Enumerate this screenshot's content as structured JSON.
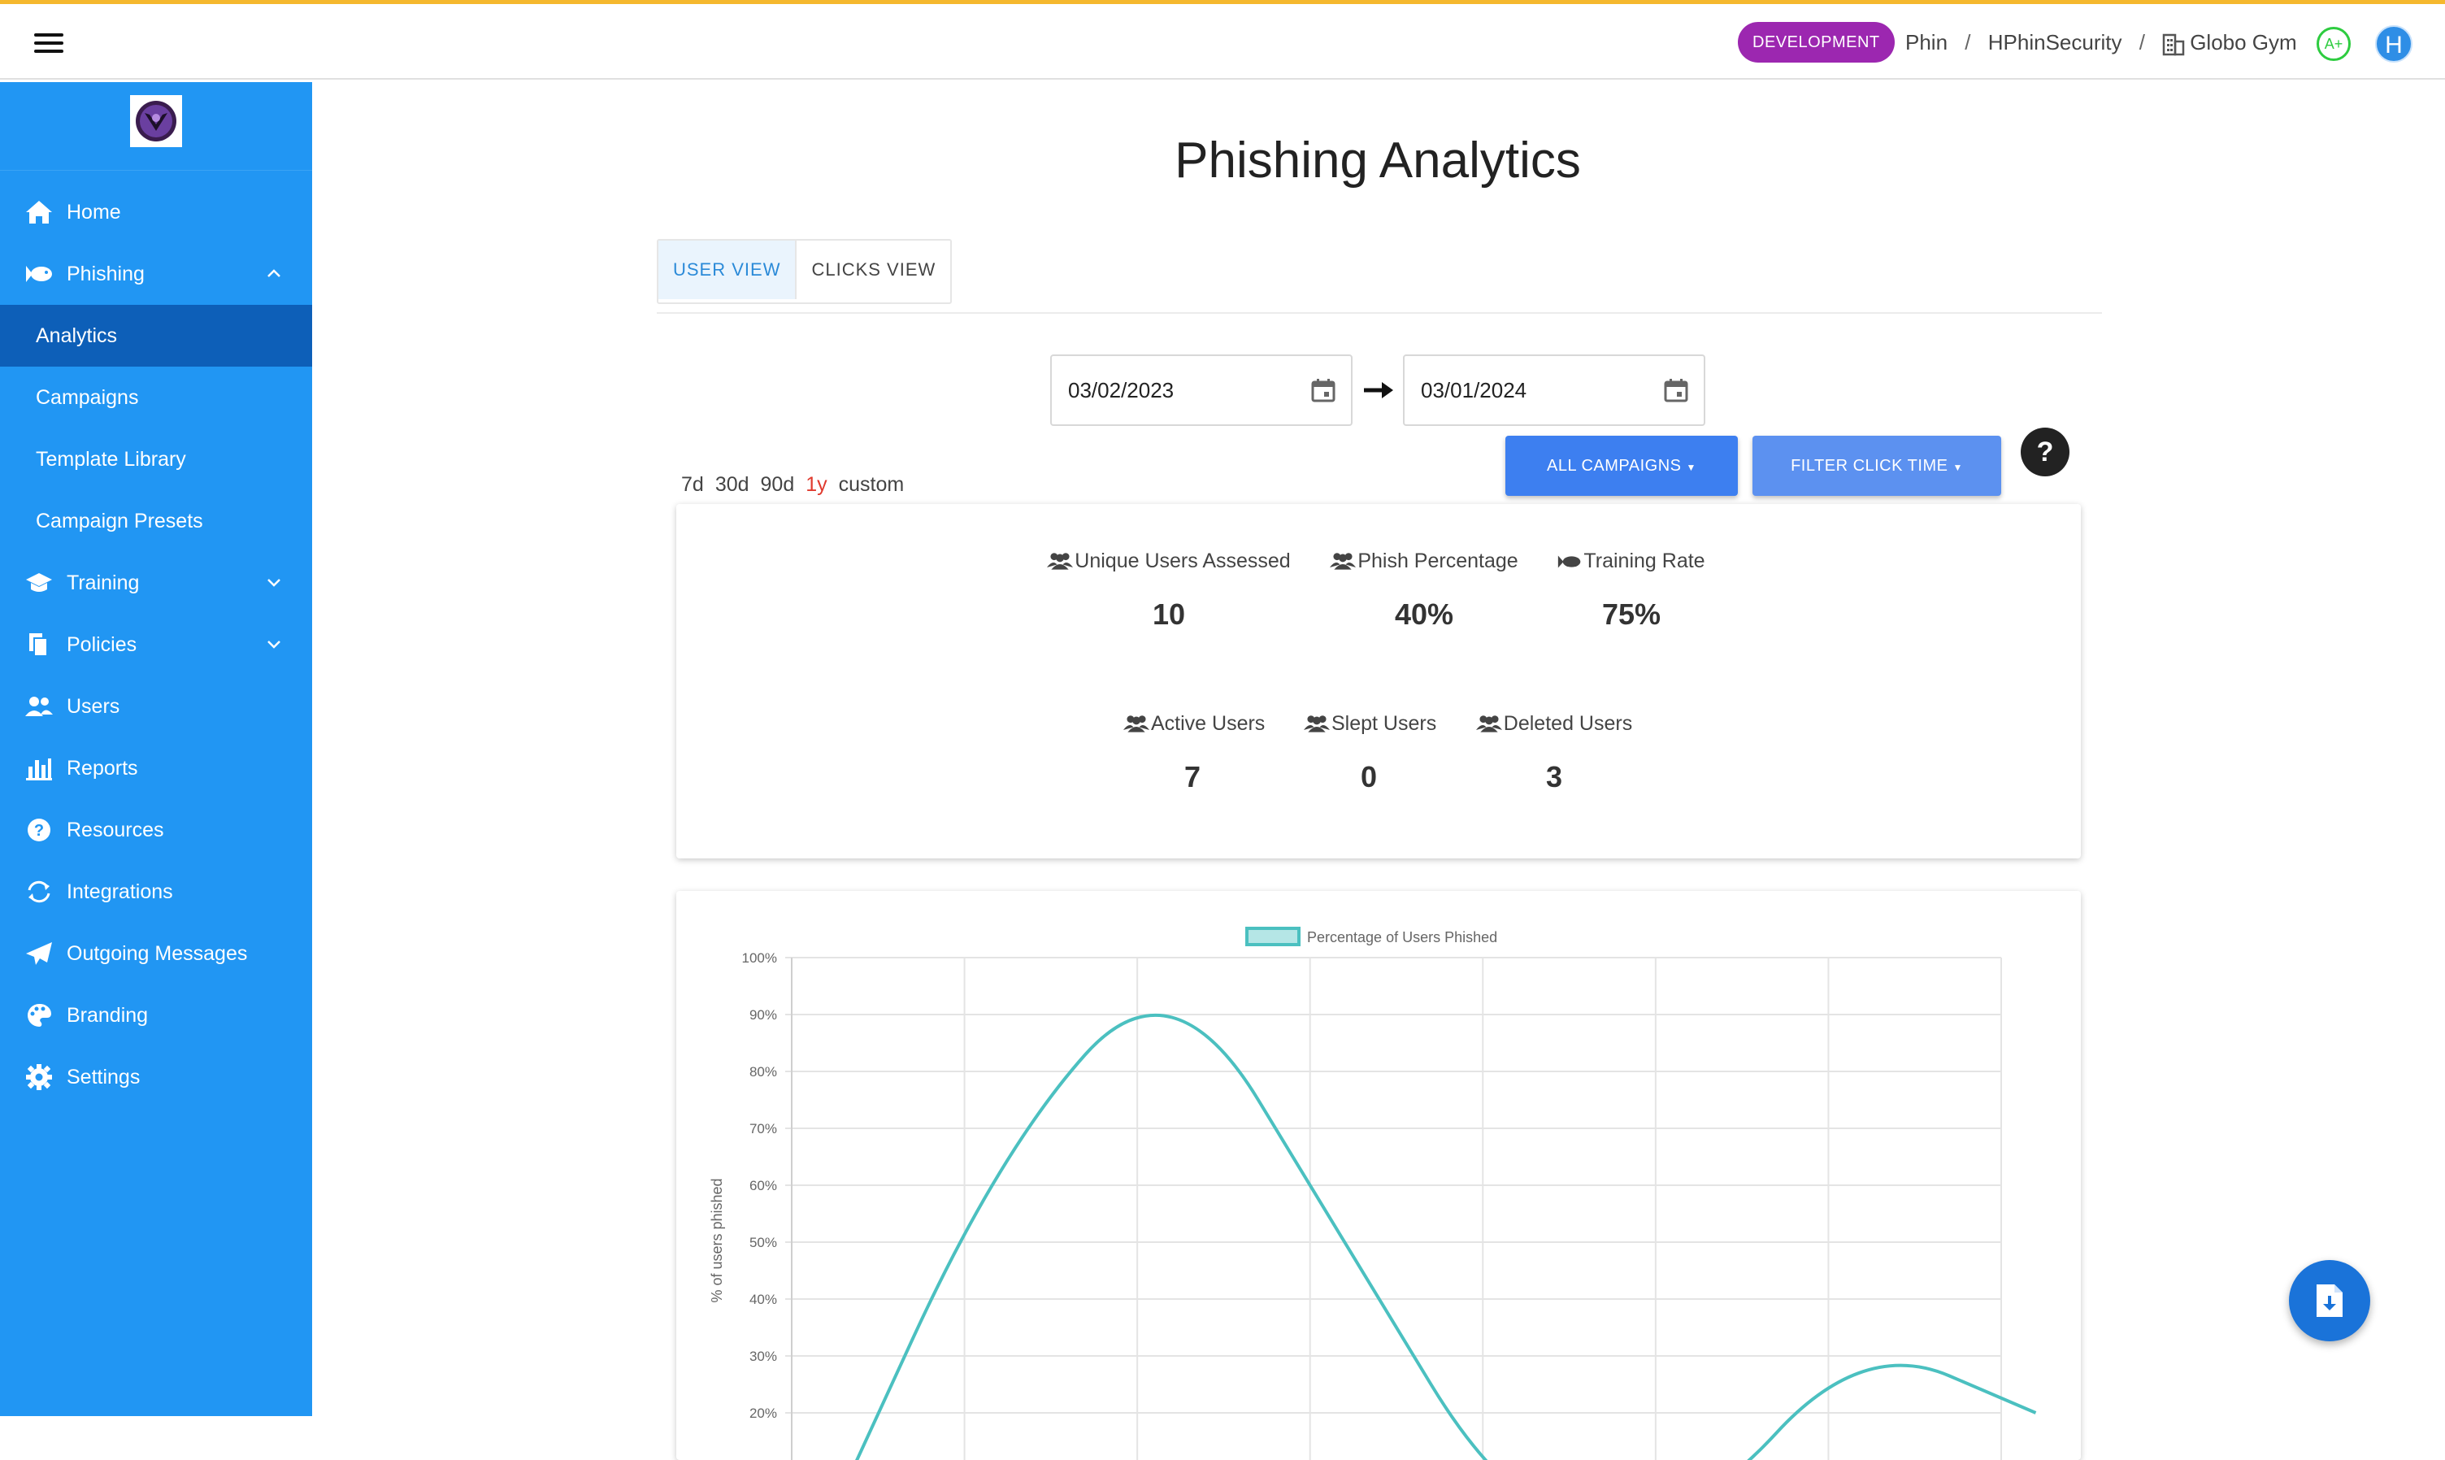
{
  "topbar": {
    "environment_badge": "DEVELOPMENT",
    "breadcrumb": [
      "Phin",
      "HPhinSecurity",
      "Globo Gym"
    ],
    "breadcrumb_separator": "/",
    "grade": "A+",
    "avatar_initial": "H",
    "accent_color": "#f5b82e"
  },
  "sidebar": {
    "color": "#2196f3",
    "items": [
      {
        "label": "Home",
        "icon": "home-icon"
      },
      {
        "label": "Phishing",
        "icon": "fish-icon",
        "expanded": true
      },
      {
        "label": "Analytics",
        "sub": true,
        "active": true
      },
      {
        "label": "Campaigns",
        "sub": true
      },
      {
        "label": "Template Library",
        "sub": true
      },
      {
        "label": "Campaign Presets",
        "sub": true
      },
      {
        "label": "Training",
        "icon": "graduation-cap-icon",
        "expandable": true
      },
      {
        "label": "Policies",
        "icon": "documents-icon",
        "expandable": true
      },
      {
        "label": "Users",
        "icon": "users-icon"
      },
      {
        "label": "Reports",
        "icon": "bar-chart-icon"
      },
      {
        "label": "Resources",
        "icon": "question-circle-icon"
      },
      {
        "label": "Integrations",
        "icon": "sync-icon"
      },
      {
        "label": "Outgoing Messages",
        "icon": "paper-plane-icon"
      },
      {
        "label": "Branding",
        "icon": "palette-icon"
      },
      {
        "label": "Settings",
        "icon": "gear-icon"
      }
    ]
  },
  "main": {
    "title": "Phishing Analytics",
    "tabs": [
      {
        "label": "USER VIEW",
        "active": true
      },
      {
        "label": "CLICKS VIEW",
        "active": false
      }
    ],
    "start_date": "03/02/2023",
    "end_date": "03/01/2024",
    "buttons": {
      "campaigns": "ALL CAMPAIGNS",
      "filter": "FILTER CLICK TIME"
    },
    "help": "?",
    "ranges": [
      {
        "label": "7d",
        "selected": false
      },
      {
        "label": "30d",
        "selected": false
      },
      {
        "label": "90d",
        "selected": false
      },
      {
        "label": "1y",
        "selected": true
      },
      {
        "label": "custom",
        "selected": false
      }
    ],
    "stats": [
      {
        "label": "Unique Users Assessed",
        "value": "10",
        "icon": "users-icon"
      },
      {
        "label": "Phish Percentage",
        "value": "40%",
        "icon": "users-icon"
      },
      {
        "label": "Training Rate",
        "value": "75%",
        "icon": "fish-icon"
      },
      {
        "label": "Active Users",
        "value": "7",
        "icon": "users-icon"
      },
      {
        "label": "Slept Users",
        "value": "0",
        "icon": "users-icon"
      },
      {
        "label": "Deleted Users",
        "value": "3",
        "icon": "users-icon"
      }
    ]
  },
  "chart_data": {
    "type": "line",
    "series": [
      {
        "name": "Percentage of Users Phished",
        "color": "#4bc0c0",
        "values": [
          null,
          0,
          66,
          100,
          50,
          0,
          0,
          33,
          20
        ]
      }
    ],
    "x_ticks_visible": 8,
    "ylabel": "% of users phished",
    "y_ticks": [
      "100%",
      "90%",
      "80%",
      "70%",
      "60%",
      "50%",
      "40%",
      "30%",
      "20%"
    ],
    "ylim": [
      0,
      100
    ],
    "grid": true,
    "legend_position": "top"
  }
}
